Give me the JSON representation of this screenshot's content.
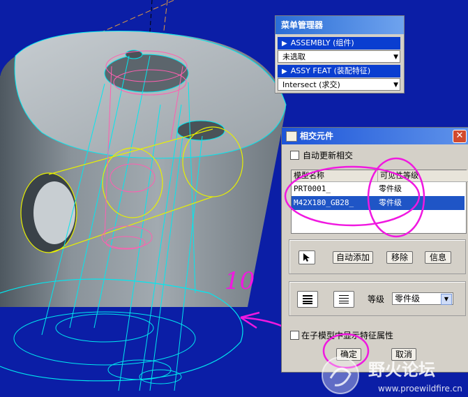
{
  "menu_manager": {
    "title": "菜单管理器",
    "item_assembly": "ASSEMBLY (组件)",
    "combo_selection": "未选取",
    "item_assy_feat": "ASSY FEAT (装配特征)",
    "combo_operation": "Intersect (求交)"
  },
  "dialog": {
    "title": "相交元件",
    "close_label": "✕",
    "auto_update_label": "自动更新相交",
    "auto_update_checked": false,
    "table": {
      "columns": [
        "模型名称",
        "可见性等级"
      ],
      "rows": [
        {
          "name": "PRT0001_",
          "level": "零件级",
          "selected": false
        },
        {
          "name": "M42X180_GB28_",
          "level": "零件级",
          "selected": true
        }
      ]
    },
    "buttons": {
      "auto_add": "自动添加",
      "remove": "移除",
      "info": "信息",
      "ok": "确定",
      "cancel": "取消"
    },
    "grade_label": "等级",
    "grade_value": "零件级",
    "show_feature_label": "在子模型中显示特征属性",
    "show_feature_checked": false
  },
  "annotation": {
    "handwritten": "10"
  },
  "watermark": {
    "brand": "野火论坛",
    "url": "www.proewildfire.cn"
  },
  "colors": {
    "viewport_bg": "#0b1ea6",
    "edge_cyan": "#00e8f0",
    "edge_yellow": "#e8f000",
    "highlight_pink": "#ff5fb0",
    "markup_magenta": "#f018e0",
    "selection_blue": "#1f55c6"
  }
}
